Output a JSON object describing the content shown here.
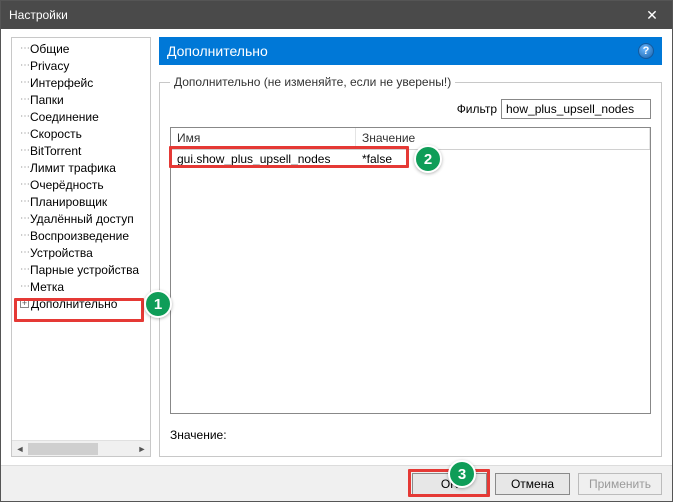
{
  "window": {
    "title": "Настройки"
  },
  "sidebar": {
    "items": [
      {
        "label": "Общие"
      },
      {
        "label": "Privacy"
      },
      {
        "label": "Интерфейс"
      },
      {
        "label": "Папки"
      },
      {
        "label": "Соединение"
      },
      {
        "label": "Скорость"
      },
      {
        "label": "BitTorrent"
      },
      {
        "label": "Лимит трафика"
      },
      {
        "label": "Очерёдность"
      },
      {
        "label": "Планировщик"
      },
      {
        "label": "Удалённый доступ"
      },
      {
        "label": "Воспроизведение"
      },
      {
        "label": "Устройства"
      },
      {
        "label": "Парные устройства"
      },
      {
        "label": "Метка"
      },
      {
        "label": "Дополнительно",
        "expandable": true,
        "selected": true
      }
    ]
  },
  "content": {
    "header": "Дополнительно",
    "group_legend": "Дополнительно (не изменяйте, если не уверены!)",
    "filter_label": "Фильтр",
    "filter_value": "how_plus_upsell_nodes",
    "table": {
      "columns": [
        "Имя",
        "Значение"
      ],
      "rows": [
        {
          "name": "gui.show_plus_upsell_nodes",
          "value": "*false"
        }
      ]
    },
    "value_label": "Значение:"
  },
  "buttons": {
    "ok": "OK",
    "cancel": "Отмена",
    "apply": "Применить"
  },
  "annotations": {
    "b1": "1",
    "b2": "2",
    "b3": "3"
  }
}
